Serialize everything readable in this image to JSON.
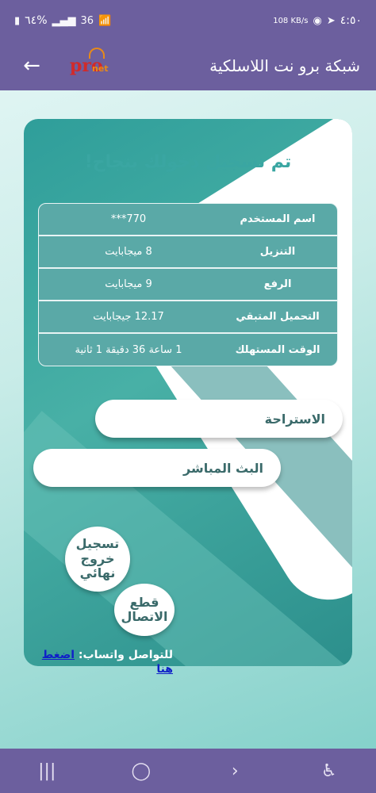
{
  "status_bar": {
    "battery": "٦٤%",
    "signal": "36",
    "speed": "108 KB/s",
    "time": "٤:٥٠"
  },
  "app_bar": {
    "title": "شبكة برو نت اللاسلكية",
    "logo_text": "pro",
    "logo_sub": "net"
  },
  "card": {
    "title": "تم تسجيل دخولك بنجاح!",
    "rows": [
      {
        "label": "اسم المستخدم",
        "value": "770***"
      },
      {
        "label": "التنزيل",
        "value": "8 ميجابايت"
      },
      {
        "label": "الرفع",
        "value": "9 ميجابايت"
      },
      {
        "label": "التحميل المتبقي",
        "value": "12.17 جيجابايت"
      },
      {
        "label": "الوقت المستهلك",
        "value": "1 ساعة 36 دقيقة 1 ثانية"
      }
    ],
    "rest_label": "الاستراحة",
    "live_label": "البث المباشر",
    "logout_label": "تسجيل خروج نهائي",
    "disconnect_label": "قطع الاتصال",
    "contact_prefix": "للتواصل واتساب:",
    "contact_link": "اضغط هنا"
  },
  "colors": {
    "bar": "#6c5f9e",
    "teal": "#3aa6a2",
    "table": "#5aa9a7"
  }
}
